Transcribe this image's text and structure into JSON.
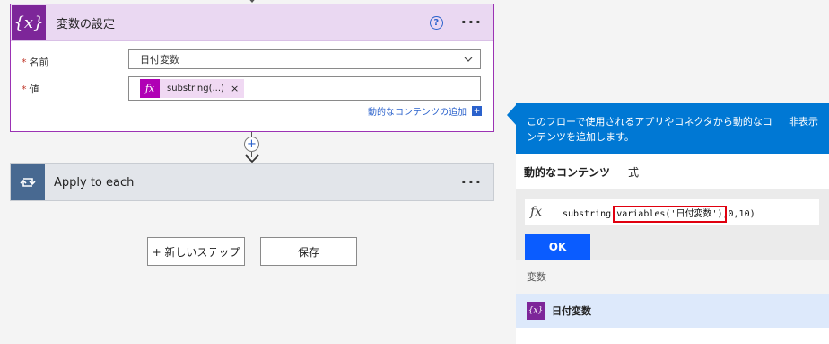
{
  "variable_card": {
    "icon": "{x}",
    "title": "変数の設定",
    "help_icon": "?",
    "more": "···",
    "name_label": "名前",
    "name_value": "日付変数",
    "value_label": "値",
    "token_label": "substring(...)",
    "token_remove": "×",
    "add_dynamic_link": "動的なコンテンツの追加",
    "add_dynamic_icon": "+"
  },
  "connector": {
    "plus": "+"
  },
  "apply_card": {
    "title": "Apply to each",
    "more": "···"
  },
  "buttons": {
    "new_step": "+ 新しいステップ",
    "save": "保存"
  },
  "panel": {
    "header_text": "このフローで使用されるアプリやコネクタから動的なコンテンツを追加します。",
    "hide_label": "非表示",
    "tabs": [
      "動的なコンテンツ",
      "式"
    ],
    "expression_prefix": "substring(",
    "expression_highlight": "variables('日付変数')",
    "expression_suffix": ",0,10)",
    "ok_label": "OK",
    "section_title": "変数",
    "variable_item": "日付変数",
    "variable_icon": "{x}"
  },
  "colors": {
    "variable_accent": "#7d2699",
    "apply_accent": "#486991",
    "panel_blue": "#0078d4",
    "ok_blue": "#0a5cff",
    "highlight_red": "#e0000f"
  }
}
